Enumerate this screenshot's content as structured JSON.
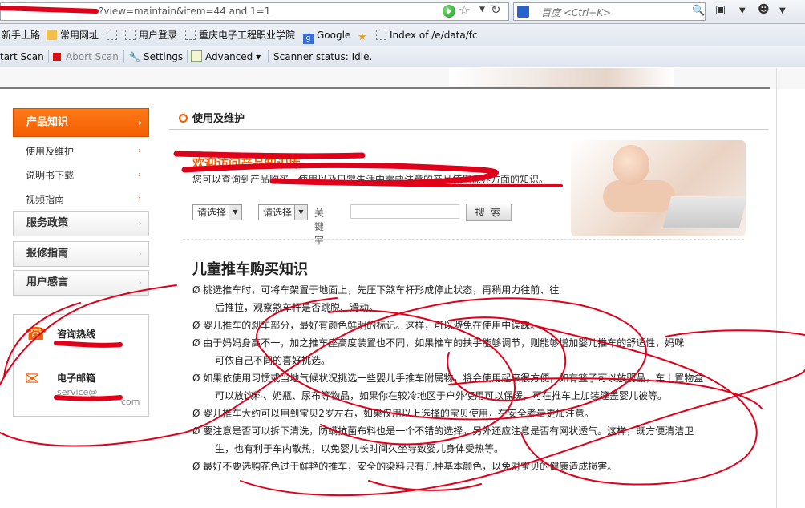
{
  "browser": {
    "url": "?view=maintain&item=44 and 1=1",
    "search_placeholder": "百度 <Ctrl+K>",
    "search_engine_icon": "baidu-paw-icon"
  },
  "bookmarks": [
    {
      "label": "新手上路",
      "icon": "page-icon"
    },
    {
      "label": "常用网址",
      "icon": "folder-icon"
    },
    {
      "label": "",
      "icon": "page-icon"
    },
    {
      "label": "用户登录",
      "icon": "page-icon"
    },
    {
      "label": "重庆电子工程职业学院",
      "icon": "page-icon"
    },
    {
      "label": "Google",
      "icon": "google-icon"
    },
    {
      "label": "Index of /e/data/fc",
      "icon": "star-icon"
    }
  ],
  "scanner_toolbar": {
    "start_scan": "tart Scan",
    "abort_scan": "Abort Scan",
    "settings": "Settings",
    "advanced": "Advanced",
    "status": "Scanner status: Idle."
  },
  "sidebar": {
    "heading": "产品知识",
    "sub_items": [
      "使用及维护",
      "说明书下载",
      "视频指南"
    ],
    "sections": [
      "服务政策",
      "报修指南",
      "用户感言"
    ],
    "contact": {
      "hotline_label": "咨询热线",
      "email_label": "电子邮箱",
      "email_prefix": "service@",
      "email_suffix": "com"
    }
  },
  "main": {
    "section_title": "使用及维护",
    "welcome": "欢迎访问产品知识库",
    "intro": "您可以查询到产品购买、使用以及日常生活中需要注意的产品使用保养方面的知识。",
    "select1": "请选择",
    "select2": "请选择",
    "keyword_label": "关键字",
    "search_button": "搜 索",
    "article_title": "儿童推车购买知识",
    "bullets": [
      "Ø 挑选推车时，可将车架置于地面上，先压下煞车杆形成停止状态，再稍用力往前、往",
      "后推拉，观察煞车杆是否跳脱、滑动。",
      "Ø 婴儿推车的刹车部分，最好有颜色鲜明的标记。这样，可以避免在使用中误踩。",
      "Ø 由于妈妈身高不一，加之推车座高度装置也不同，如果推车的扶手能够调节，则能够增加婴儿推车的舒适性，妈咪",
      "可依自己不同的喜好挑选。",
      "Ø 如果依使用习惯或当地气候状况挑选一些婴儿手推车附属物，将会使用起来很方便，如有篮子可以放婴品，车上置物盒",
      "可以放饮料、奶瓶、尿布等物品，如果你在较冷地区于户外使用可以保暖，可在推车上加装篷盖婴儿被等。",
      "Ø 婴儿推车大约可以用到宝贝2岁左右，如果仅用以上选择的宝贝使用，在安全考量更加注意。",
      "Ø 要注意是否可以拆下清洗，防螨抗菌布料也是一个不错的选择，另外还应注意是否有网状透气。这样，既方便清洁卫",
      "生，也有利于车内散热，以免婴儿长时间久坐导致婴儿身体受热等。",
      "Ø 最好不要选购花色过于鲜艳的推车，安全的染料只有几种基本颜色，以免对宝贝的健康造成损害。"
    ]
  },
  "colors": {
    "accent": "#f25e00",
    "scribble": "#e0001a"
  }
}
